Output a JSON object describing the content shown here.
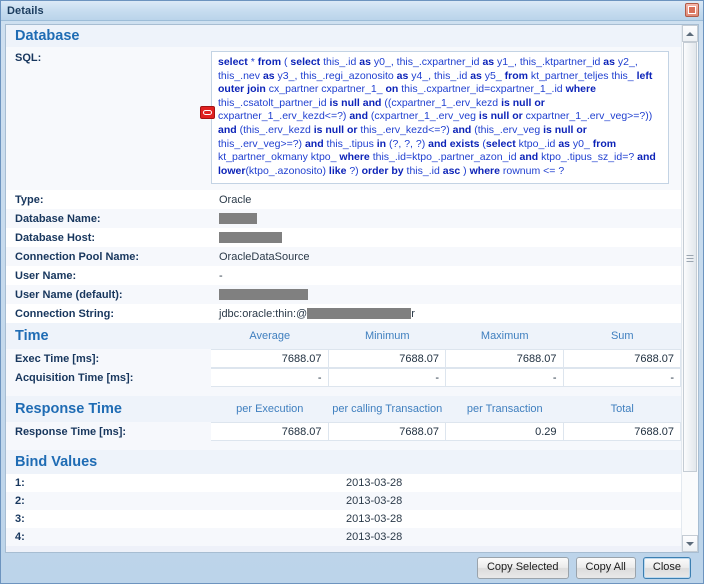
{
  "window": {
    "title": "Details",
    "close_icon": "window-close-icon"
  },
  "database": {
    "heading": "Database",
    "sql_label": "SQL:",
    "sql_error_icon": "error-stop-icon",
    "sql_lines": [
      "select * from ( select this_.id as y0_, this_.cxpartner_id as y1_, this_.ktpartner_id as y2_,",
      "this_.nev as y3_, this_.regi_azonosito as y4_, this_.id as y5_ from kt_partner_teljes this_ left",
      " outer join cx_partner cxpartner_1_ on this_.cxpartner_id=cxpartner_1_.id where",
      "this_.csatolt_partner_id is null and ((cxpartner_1_.erv_kezd is null or cxpartner_1_.erv_kezd<=?)",
      "and (cxpartner_1_.erv_veg is null or cxpartner_1_.erv_veg>=?)) and (this_.erv_kezd is null or",
      "this_.erv_kezd<=?) and (this_.erv_veg is null or this_.erv_veg>=?) and this_.tipus in (?, ?, ?) and",
      " exists (select ktpo_.id as y0_ from kt_partner_okmany ktpo_ where",
      "this_.id=ktpo_.partner_azon_id and ktpo_.tipus_sz_id=? and lower(ktpo_.azonosito) like ?)",
      "order by this_.id asc ) where rownum <= ?"
    ],
    "rows": [
      {
        "label": "Type:",
        "value": "Oracle",
        "redacted": false
      },
      {
        "label": "Database Name:",
        "value": "",
        "redacted": true,
        "redact_width": 38
      },
      {
        "label": "Database Host:",
        "value": "",
        "redacted": true,
        "redact_width": 63
      },
      {
        "label": "Connection Pool Name:",
        "value": "OracleDataSource",
        "redacted": false
      },
      {
        "label": "User Name:",
        "value": "-",
        "redacted": false
      },
      {
        "label": "User Name (default):",
        "value": "",
        "redacted": true,
        "redact_width": 89
      },
      {
        "label": "Connection String:",
        "value": "jdbc:oracle:thin:@",
        "redacted": true,
        "redact_width": 104,
        "suffix": "r"
      }
    ]
  },
  "time": {
    "heading": "Time",
    "columns": [
      "Average",
      "Minimum",
      "Maximum",
      "Sum"
    ],
    "rows": [
      {
        "label": "Exec Time [ms]:",
        "values": [
          "7688.07",
          "7688.07",
          "7688.07",
          "7688.07"
        ]
      },
      {
        "label": "Acquisition Time [ms]:",
        "values": [
          "-",
          "-",
          "-",
          "-"
        ]
      }
    ]
  },
  "response_time": {
    "heading": "Response Time",
    "columns": [
      "per Execution",
      "per calling Transaction",
      "per Transaction",
      "Total"
    ],
    "rows": [
      {
        "label": "Response Time [ms]:",
        "values": [
          "7688.07",
          "7688.07",
          "0.29",
          "7688.07"
        ]
      }
    ]
  },
  "bind_values": {
    "heading": "Bind Values",
    "rows": [
      {
        "key": "1:",
        "value": "2013-03-28"
      },
      {
        "key": "2:",
        "value": "2013-03-28"
      },
      {
        "key": "3:",
        "value": "2013-03-28"
      },
      {
        "key": "4:",
        "value": "2013-03-28"
      }
    ]
  },
  "footer": {
    "copy_selected": "Copy Selected",
    "copy_all": "Copy All",
    "close": "Close"
  },
  "scrollbar": {
    "up_icon": "scroll-up-arrow-icon",
    "down_icon": "scroll-down-arrow-icon",
    "thumb": "scrollbar-thumb"
  }
}
